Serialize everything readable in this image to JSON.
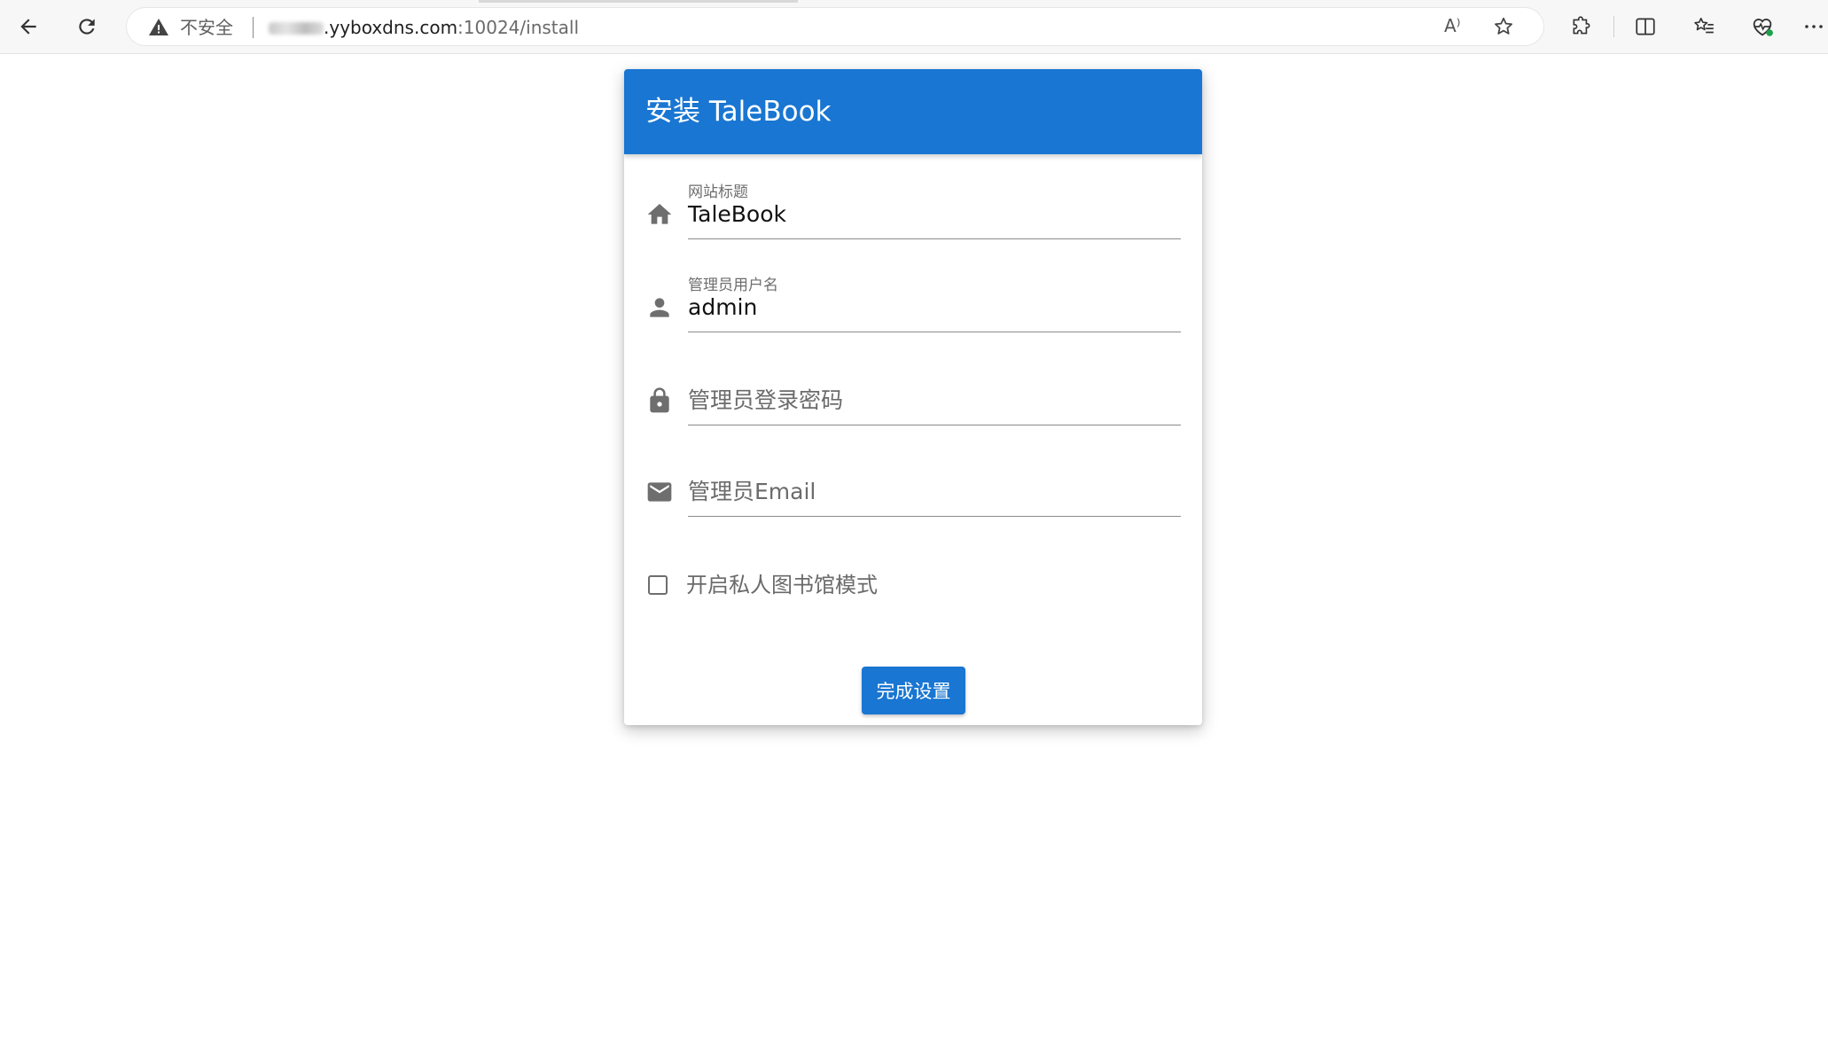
{
  "browser": {
    "security_label": "不安全",
    "url_host": ".yyboxdns.com",
    "url_path": ":10024/install",
    "read_aloud_glyph": "A⁾",
    "icons": {
      "back": "back-arrow-icon",
      "refresh": "refresh-icon",
      "warning": "warning-icon",
      "favorite": "star-icon",
      "extensions": "extensions-icon",
      "split": "split-screen-icon",
      "favorites_list": "favorites-list-icon",
      "health": "browser-essentials-icon",
      "more": "more-icon"
    }
  },
  "install": {
    "title": "安装 TaleBook",
    "fields": [
      {
        "label": "网站标题",
        "value": "TaleBook",
        "icon": "home-icon"
      },
      {
        "label": "管理员用户名",
        "value": "admin",
        "icon": "person-icon"
      },
      {
        "placeholder": "管理员登录密码",
        "icon": "lock-icon"
      },
      {
        "placeholder": "管理员Email",
        "icon": "mail-icon"
      }
    ],
    "private_mode_label": "开启私人图书馆模式",
    "submit_label": "完成设置"
  },
  "colors": {
    "primary": "#1976d2",
    "icon_gray": "#6e6e6e"
  }
}
